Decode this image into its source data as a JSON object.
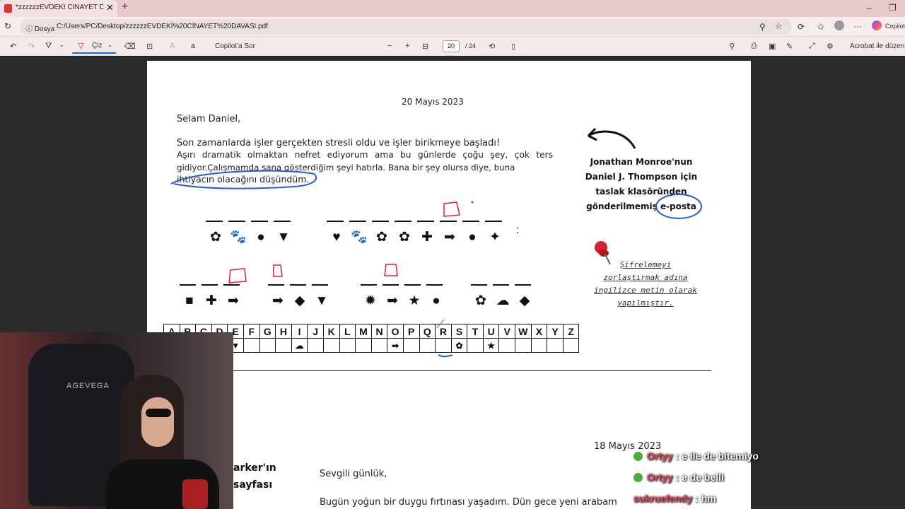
{
  "browser": {
    "tab_title": "*zzzzzzEVDEKİ CİNAYET DAVASI.p",
    "new_tab": "+",
    "close": "✕",
    "site_info": "Dosya",
    "url": "C:/Users/PC/Desktop/zzzzzzEVDEKİ%20CİNAYET%20DAVASI.pdf",
    "copilot": "Copilot"
  },
  "pdf_toolbar": {
    "draw_label": "Çiz",
    "copilot_label": "Copilot'a Sor",
    "zoom_out": "−",
    "zoom_in": "+",
    "page_current": "20",
    "page_total": "/ 24",
    "acrobat_label": "Acrobat ile düzenle"
  },
  "letter": {
    "date": "20 Mayıs 2023",
    "greeting": "Selam Daniel,",
    "line1": "Son zamanlarda işler gerçekten stresli oldu ve işler birikmeye başladı!",
    "line2": "Aşırı dramatik olmaktan nefret ediyorum ama bu günlerde çoğu şey, çok ters",
    "line3": "gidiyor.Çalışmamda sana gösterdiğim şeyi hatırla. Bana bir şey olursa diye, buna",
    "line4": "ihtiyacın olacağını düşündüm."
  },
  "side_note": {
    "line1": "Jonathan Monroe'nun",
    "line2": "Daniel J. Thompson için",
    "line3": "taslak klasöründen",
    "line4": "gönderilmemiş e-posta"
  },
  "pin_note": {
    "line1": "Şifrelemeyi",
    "line2": "zorlaştırmak adına",
    "line3": "ingilizce metin olarak",
    "line4": "yapılmıştır."
  },
  "cipher": {
    "row1_symbols": [
      "✿",
      "🐾",
      "●",
      "▼"
    ],
    "row1b_symbols": [
      "♥",
      "🐾",
      "✿",
      "✿",
      "✚",
      "➡",
      "●",
      "✦"
    ],
    "row2a_symbols": [
      "■",
      "✚",
      "➡"
    ],
    "row2b_symbols": [
      "➡",
      "◆",
      "▼"
    ],
    "row2c_symbols": [
      "✹",
      "➡",
      "★",
      "●"
    ],
    "row2d_symbols": [
      "✿",
      "☁",
      "◆"
    ],
    "colon": ":",
    "letters": [
      "A",
      "B",
      "C",
      "D",
      "E",
      "F",
      "G",
      "H",
      "I",
      "J",
      "K",
      "L",
      "M",
      "N",
      "O",
      "P",
      "Q",
      "R",
      "S",
      "T",
      "U",
      "V",
      "W",
      "X",
      "Y",
      "Z"
    ],
    "key_row": [
      "",
      "",
      "",
      "",
      "▼",
      "",
      "",
      "",
      "☁",
      "",
      "",
      "",
      "",
      "",
      "➡",
      "",
      "",
      "",
      "✿",
      "",
      "★",
      "",
      "",
      "",
      "",
      ""
    ]
  },
  "diary": {
    "date": "18 Mayıs 2023",
    "side_title1": "arker'ın",
    "side_title2": "sayfası",
    "greeting": "Sevgili günlük,",
    "line1": "Bugün yoğun bir duygu fırtınası yaşadım. Dün gece yeni arabam"
  },
  "webcam": {
    "chair_brand": "AGEVEGA"
  },
  "chat": [
    {
      "name": "Ortyy",
      "message": ": e ile de bitemiyo"
    },
    {
      "name": "Ortyy",
      "message": ": e de belli"
    },
    {
      "name": "sukruefendy",
      "message": ": hm"
    }
  ]
}
